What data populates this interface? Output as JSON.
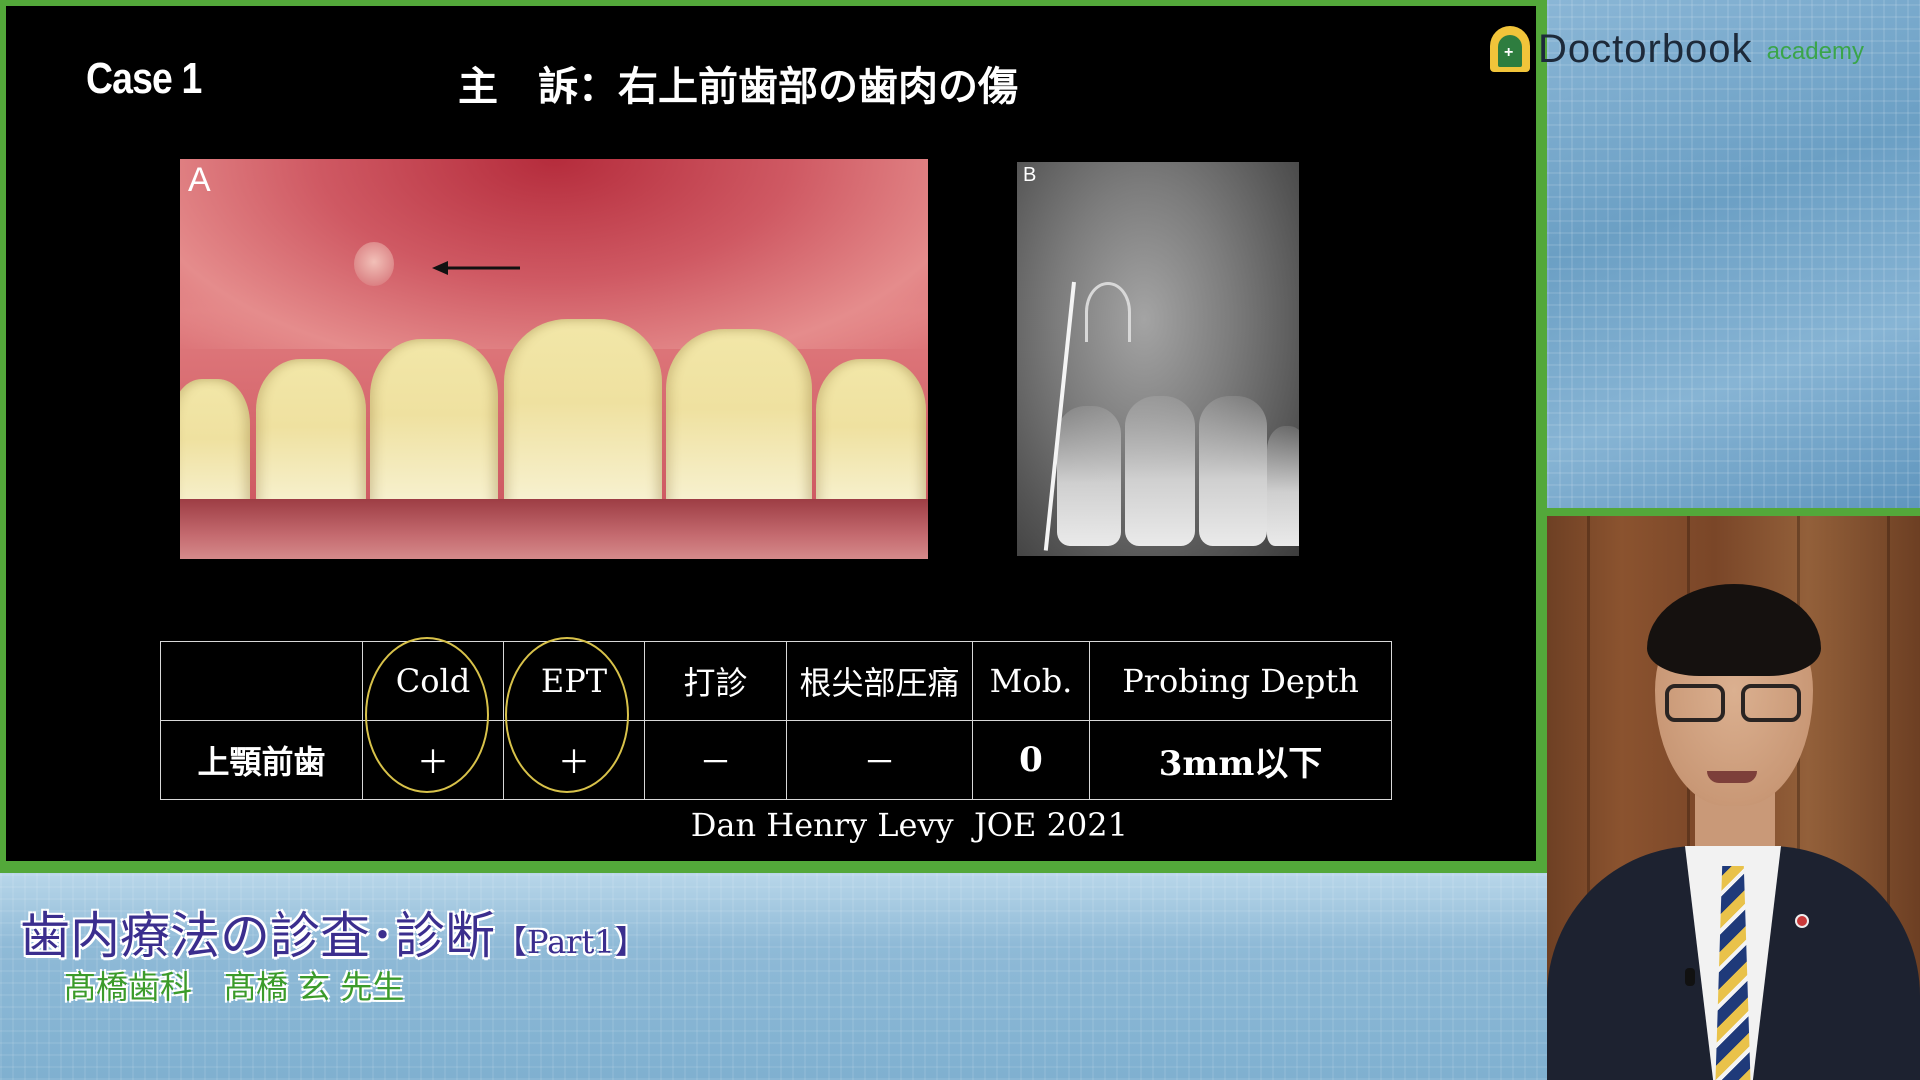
{
  "slide": {
    "case_label": "Case 1",
    "complaint": "主　訴：右上前歯部の歯肉の傷",
    "photo_a_label": "A",
    "photo_b_label": "B",
    "citation": "Dan Henry Levy  JOE 2021"
  },
  "table": {
    "headers": [
      "",
      "Cold",
      "EPT",
      "打診",
      "根尖部圧痛",
      "Mob.",
      "Probing Depth"
    ],
    "row_label": "上顎前歯",
    "values": [
      "＋",
      "＋",
      "－",
      "－",
      "0",
      "3mm以下"
    ]
  },
  "logo": {
    "name": "Doctorbook",
    "sub": "academy"
  },
  "lecture": {
    "title": "歯内療法の診査･診断",
    "part": "【Part1】",
    "speaker": "髙橋歯科　髙橋 玄 先生"
  },
  "colors": {
    "frame_green": "#53a83a",
    "circle_gold": "#d8c24a",
    "title_purple": "#3b2e8e",
    "speaker_green": "#3b9b2a"
  }
}
